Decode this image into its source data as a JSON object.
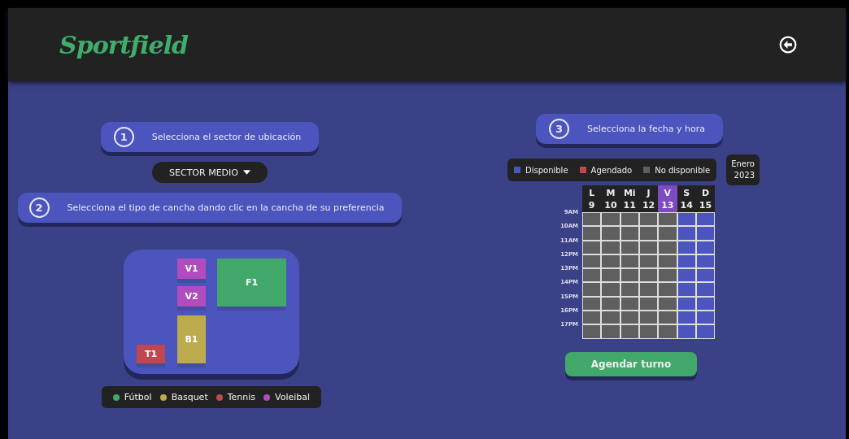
{
  "header": {
    "logo": "Sportfield"
  },
  "steps": [
    {
      "number": "1",
      "text": "Selecciona el sector de ubicación"
    },
    {
      "number": "2",
      "text": "Selecciona el tipo de cancha dando clic en la cancha de su preferencia"
    },
    {
      "number": "3",
      "text": "Selecciona la fecha y hora"
    }
  ],
  "sector_dropdown": {
    "value": "SECTOR MEDIO"
  },
  "courts": [
    {
      "label": "V1",
      "color": "#b04cbd"
    },
    {
      "label": "V2",
      "color": "#b04cbd"
    },
    {
      "label": "B1",
      "color": "#bbab4c"
    },
    {
      "label": "F1",
      "color": "#41a86a"
    },
    {
      "label": "T1",
      "color": "#c0474f"
    }
  ],
  "court_legend": [
    {
      "label": "Fútbol",
      "color": "#41a86a"
    },
    {
      "label": "Basquet",
      "color": "#bbab4c"
    },
    {
      "label": "Tennis",
      "color": "#c0474f"
    },
    {
      "label": "Voleibal",
      "color": "#b04cbd"
    }
  ],
  "slot_legend": [
    {
      "label": "Disponible",
      "color": "#4b55bd"
    },
    {
      "label": "Agendado",
      "color": "#c0474f"
    },
    {
      "label": "No disponible",
      "color": "#5f5f5f"
    }
  ],
  "month": {
    "name": "Enero",
    "year": "2023"
  },
  "days": [
    {
      "letter": "L",
      "number": "9",
      "selected": false
    },
    {
      "letter": "M",
      "number": "10",
      "selected": false
    },
    {
      "letter": "Mi",
      "number": "11",
      "selected": false
    },
    {
      "letter": "J",
      "number": "12",
      "selected": false
    },
    {
      "letter": "V",
      "number": "13",
      "selected": true
    },
    {
      "letter": "S",
      "number": "14",
      "selected": false
    },
    {
      "letter": "D",
      "number": "15",
      "selected": false
    }
  ],
  "schedule": [
    {
      "hour": "9AM",
      "slots": [
        {
          "kind": "unavailable"
        },
        {
          "kind": "unavailable"
        },
        {
          "kind": "unavailable"
        },
        {
          "kind": "unavailable"
        },
        {
          "kind": "unavailable"
        },
        {
          "kind": "available"
        },
        {
          "kind": "available"
        }
      ]
    },
    {
      "hour": "10AM",
      "slots": [
        {
          "kind": "unavailable"
        },
        {
          "kind": "unavailable"
        },
        {
          "kind": "unavailable"
        },
        {
          "kind": "unavailable"
        },
        {
          "kind": "unavailable"
        },
        {
          "kind": "available"
        },
        {
          "kind": "available"
        }
      ]
    },
    {
      "hour": "11AM",
      "slots": [
        {
          "kind": "unavailable"
        },
        {
          "kind": "unavailable"
        },
        {
          "kind": "unavailable"
        },
        {
          "kind": "unavailable"
        },
        {
          "kind": "unavailable"
        },
        {
          "kind": "available"
        },
        {
          "kind": "available"
        }
      ]
    },
    {
      "hour": "12PM",
      "slots": [
        {
          "kind": "unavailable"
        },
        {
          "kind": "unavailable"
        },
        {
          "kind": "unavailable"
        },
        {
          "kind": "unavailable"
        },
        {
          "kind": "unavailable"
        },
        {
          "kind": "available"
        },
        {
          "kind": "available"
        }
      ]
    },
    {
      "hour": "13PM",
      "slots": [
        {
          "kind": "unavailable"
        },
        {
          "kind": "unavailable"
        },
        {
          "kind": "unavailable"
        },
        {
          "kind": "unavailable"
        },
        {
          "kind": "unavailable"
        },
        {
          "kind": "available"
        },
        {
          "kind": "available"
        }
      ]
    },
    {
      "hour": "14PM",
      "slots": [
        {
          "kind": "unavailable"
        },
        {
          "kind": "unavailable"
        },
        {
          "kind": "unavailable"
        },
        {
          "kind": "unavailable"
        },
        {
          "kind": "unavailable"
        },
        {
          "kind": "available"
        },
        {
          "kind": "available"
        }
      ]
    },
    {
      "hour": "15PM",
      "slots": [
        {
          "kind": "unavailable"
        },
        {
          "kind": "unavailable"
        },
        {
          "kind": "unavailable"
        },
        {
          "kind": "unavailable"
        },
        {
          "kind": "unavailable"
        },
        {
          "kind": "available"
        },
        {
          "kind": "available"
        }
      ]
    },
    {
      "hour": "16PM",
      "slots": [
        {
          "kind": "unavailable"
        },
        {
          "kind": "unavailable"
        },
        {
          "kind": "unavailable"
        },
        {
          "kind": "unavailable"
        },
        {
          "kind": "unavailable"
        },
        {
          "kind": "available"
        },
        {
          "kind": "available"
        }
      ]
    },
    {
      "hour": "17PM",
      "slots": [
        {
          "kind": "unavailable"
        },
        {
          "kind": "unavailable"
        },
        {
          "kind": "unavailable"
        },
        {
          "kind": "unavailable"
        },
        {
          "kind": "unavailable"
        },
        {
          "kind": "available"
        },
        {
          "kind": "available"
        }
      ]
    }
  ],
  "book_button": {
    "label": "Agendar turno"
  }
}
